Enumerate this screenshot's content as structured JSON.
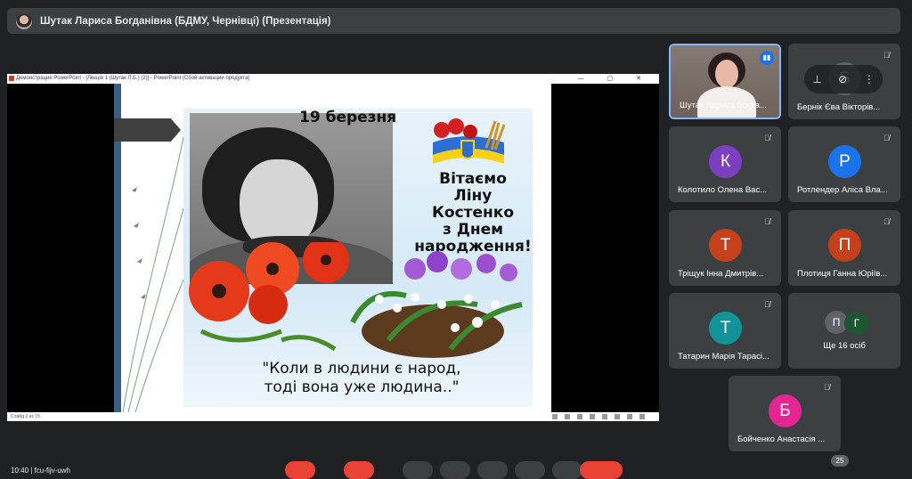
{
  "presenter_bar": {
    "title": "Шутак Лариса Богданівна (БДМУ, Чернівці) (Презентація)"
  },
  "presentation": {
    "window_title": "Демонстрация PowerPoint - [Лекція 1 (Шутак Л.Б.) (2)] - PowerPoint (Сбой активации продукта)",
    "window_controls": "— ▢ ✕",
    "status_text": "Слайд 2 из 15",
    "slide": {
      "date": "19 березня",
      "greeting": [
        "Вітаємо",
        "Ліну",
        "Костенко",
        "з Днем",
        "народження!"
      ],
      "quote": [
        "\"Коли в людини є народ,",
        "тоді вона уже людина..\""
      ]
    }
  },
  "participants": [
    {
      "name": "Шутак Лариса Богда...",
      "type": "video",
      "speaking": true
    },
    {
      "name": "Бернік Єва Вікторів...",
      "initial": "Б",
      "color": "#5f6368",
      "hovered": true
    },
    {
      "name": "Колотило Олена Вас...",
      "initial": "К",
      "color": "#7b3fbf"
    },
    {
      "name": "Ротлендер Аліса Вла...",
      "initial": "Р",
      "color": "#1a73e8"
    },
    {
      "name": "Тріщук Інна Дмитрів...",
      "initial": "Т",
      "color": "#c5411b"
    },
    {
      "name": "Плотиця Ганна Юріїв...",
      "initial": "П",
      "color": "#c5411b"
    },
    {
      "name": "Татарин Марія Тарасі...",
      "initial": "Т",
      "color": "#12939a"
    },
    {
      "name": "Бойченко Анастасія ...",
      "initial": "Б",
      "color": "#e52592"
    }
  ],
  "more_tile": {
    "label": "Ще 16 осіб",
    "initials": [
      "П",
      "Г"
    ],
    "colors": [
      "#5f6368",
      "#1e5631"
    ]
  },
  "bottom_bar": {
    "meeting_code": "10:40 | fcu-fijv-uwh",
    "participant_count": "25"
  },
  "colors": {
    "background": "#202124",
    "tile": "#3c4043",
    "accent": "#8ab4f8",
    "end_call": "#ea4335"
  }
}
